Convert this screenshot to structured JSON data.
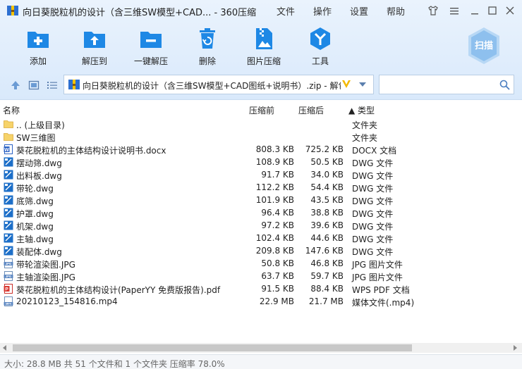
{
  "window": {
    "title": "向日葵脱粒机的设计（含三维SW模型+CAD... - 360压缩",
    "menus": [
      "文件",
      "操作",
      "设置",
      "帮助"
    ]
  },
  "toolbar": {
    "add": "添加",
    "extract_to": "解压到",
    "one_click": "一键解压",
    "delete": "删除",
    "image_compress": "图片压缩",
    "tools": "工具",
    "scan": "扫描"
  },
  "address": {
    "path": "向日葵脱粒机的设计（含三维SW模型+CAD图纸+说明书）.zip - 解包"
  },
  "columns": {
    "name": "名称",
    "compressed_before": "压缩前",
    "compressed_after": "压缩后",
    "type": "▲ 类型"
  },
  "files": [
    {
      "name": ".. (上级目录)",
      "before": "",
      "after": "",
      "type": "文件夹",
      "icon": "folder-icon"
    },
    {
      "name": "SW三维图",
      "before": "",
      "after": "",
      "type": "文件夹",
      "icon": "folder-icon"
    },
    {
      "name": "葵花脱粒机的主体结构设计说明书.docx",
      "before": "808.3 KB",
      "after": "725.2 KB",
      "type": "DOCX 文档",
      "icon": "docx-icon"
    },
    {
      "name": "摆动筛.dwg",
      "before": "108.9 KB",
      "after": "50.5 KB",
      "type": "DWG 文件",
      "icon": "dwg-icon"
    },
    {
      "name": "出料板.dwg",
      "before": "91.7 KB",
      "after": "34.0 KB",
      "type": "DWG 文件",
      "icon": "dwg-icon"
    },
    {
      "name": "带轮.dwg",
      "before": "112.2 KB",
      "after": "54.4 KB",
      "type": "DWG 文件",
      "icon": "dwg-icon"
    },
    {
      "name": "底筛.dwg",
      "before": "101.9 KB",
      "after": "43.5 KB",
      "type": "DWG 文件",
      "icon": "dwg-icon"
    },
    {
      "name": "护罩.dwg",
      "before": "96.4 KB",
      "after": "38.8 KB",
      "type": "DWG 文件",
      "icon": "dwg-icon"
    },
    {
      "name": "机架.dwg",
      "before": "97.2 KB",
      "after": "39.6 KB",
      "type": "DWG 文件",
      "icon": "dwg-icon"
    },
    {
      "name": "主轴.dwg",
      "before": "102.4 KB",
      "after": "44.6 KB",
      "type": "DWG 文件",
      "icon": "dwg-icon"
    },
    {
      "name": "装配体.dwg",
      "before": "209.8 KB",
      "after": "147.6 KB",
      "type": "DWG 文件",
      "icon": "dwg-icon"
    },
    {
      "name": "带轮渲染图.JPG",
      "before": "50.8 KB",
      "after": "46.8 KB",
      "type": "JPG 图片文件",
      "icon": "jpg-icon"
    },
    {
      "name": "主轴渲染图.JPG",
      "before": "63.7 KB",
      "after": "59.7 KB",
      "type": "JPG 图片文件",
      "icon": "jpg-icon"
    },
    {
      "name": "葵花脱粒机的主体结构设计(PaperYY 免费版报告).pdf",
      "before": "91.5 KB",
      "after": "88.4 KB",
      "type": "WPS PDF 文档",
      "icon": "pdf-icon"
    },
    {
      "name": "20210123_154816.mp4",
      "before": "22.9 MB",
      "after": "21.7 MB",
      "type": "媒体文件(.mp4)",
      "icon": "mp4-icon"
    }
  ],
  "status": {
    "text": "大小: 28.8 MB 共 51 个文件和 1 个文件夹 压缩率 78.0%"
  },
  "colors": {
    "accent": "#1e88e5",
    "toolbar_bg": "#dcebfb",
    "scan_badge": "#9cc9f2"
  }
}
